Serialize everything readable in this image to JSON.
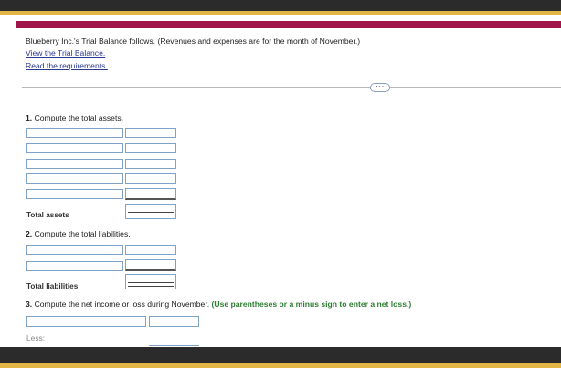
{
  "intro": {
    "text": "Blueberry Inc.'s Trial Balance follows. (Revenues and expenses are for the month of November.)",
    "link_trial": "View the Trial Balance.",
    "link_requirements": "Read the requirements."
  },
  "expand_label": "···",
  "q1": {
    "number": "1.",
    "text": "Compute the total assets.",
    "total_label": "Total assets"
  },
  "q2": {
    "number": "2.",
    "text": "Compute the total liabilities.",
    "total_label": "Total liabilities"
  },
  "q3": {
    "number": "3.",
    "text": "Compute the net income or loss during November.",
    "hint": "(Use parentheses or a minus sign to enter a net loss.)",
    "less_label": "Less:"
  },
  "colors": {
    "accent_crimson": "#a0154a",
    "accent_gold": "#e3b548",
    "link_blue": "#2a3a8f",
    "hint_green": "#2e7d32",
    "input_border": "#7fa3c8"
  }
}
